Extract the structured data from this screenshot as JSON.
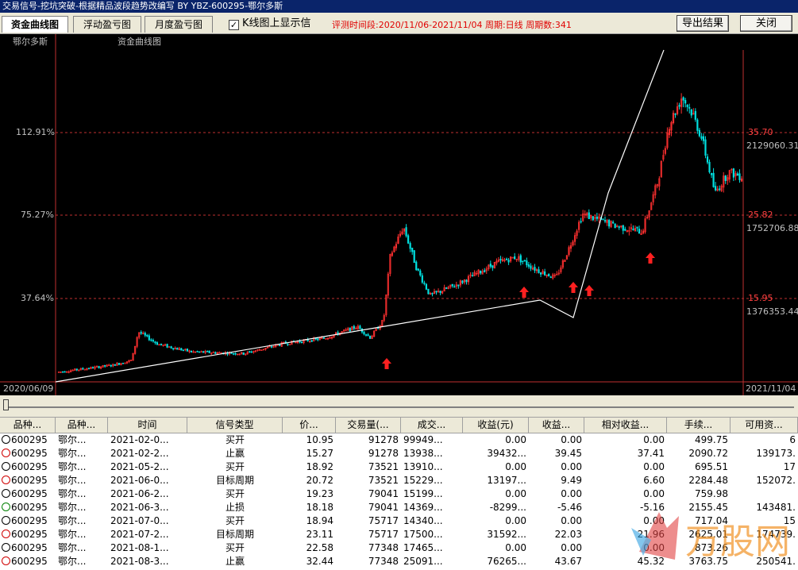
{
  "window": {
    "title": "交易信号-挖坑突破-根据精品波段趋势改编写 BY YBZ-600295-鄂尔多斯"
  },
  "tabs": [
    {
      "label": "资金曲线图",
      "active": true
    },
    {
      "label": "浮动盈亏图",
      "active": false
    },
    {
      "label": "月度盈亏图",
      "active": false
    }
  ],
  "kline_checkbox": {
    "label": "K线图上显示信",
    "checked": true
  },
  "period_info": "评测时间段:2020/11/06-2021/11/04  周期:日线  周期数:341",
  "buttons": {
    "export": "导出结果",
    "close": "关闭"
  },
  "chart": {
    "stock_name": "鄂尔多斯",
    "title": "资金曲线图",
    "left_axis": [
      "112.91%",
      "75.27%",
      "37.64%"
    ],
    "right_price": [
      "35.70",
      "25.82",
      "15.95"
    ],
    "right_capital": [
      "2129060.31",
      "1752706.88",
      "1376353.44"
    ],
    "date_start": "2020/06/09",
    "date_end": "2021/11/04",
    "colors": {
      "up": "#ff3030",
      "down": "#00e0e0",
      "line": "#ffffff",
      "grid": "#c03030",
      "signal": "#ff2020"
    }
  },
  "chart_data": {
    "type": "line",
    "x": [
      "2020/06/09",
      "2021-02-0..",
      "2021-05-2..",
      "2021-06-0..",
      "2021-07-0..",
      "2021-08-3.."
    ],
    "series": [],
    "ylabel": "",
    "left_ticks": [
      "112.91%",
      "75.27%",
      "37.64%"
    ],
    "right_price_ticks": [
      35.7,
      25.82,
      15.95
    ],
    "right_capital_ticks": [
      2129060.31,
      1752706.88,
      1376353.44
    ],
    "price_range_visible": [
      7,
      42
    ],
    "capital_curve_points": [
      [
        0,
        0.0
      ],
      [
        0.68,
        0.38
      ],
      [
        0.75,
        0.43
      ],
      [
        0.78,
        0.38
      ],
      [
        0.82,
        0.74
      ],
      [
        1.0,
        1.2
      ]
    ],
    "buy_signal_positions": [
      0.48,
      0.66,
      0.72,
      0.74,
      0.82
    ]
  },
  "table": {
    "headers": [
      "品种...",
      "品种...",
      "时间",
      "信号类型",
      "价...",
      "交易量(...",
      "成交...",
      "收益(元)",
      "收益...",
      "相对收益...",
      "手续...",
      "可用资..."
    ],
    "rows": [
      {
        "face": "black",
        "code": "600295",
        "name": "鄂尔...",
        "time": "2021-02-0...",
        "type": "买开",
        "price": "10.95",
        "volume": "91278",
        "amount": "99949...",
        "profit": "0.00",
        "profit_pct": "0.00",
        "rel": "0.00",
        "fee": "499.75",
        "avail": "6"
      },
      {
        "face": "red",
        "code": "600295",
        "name": "鄂尔...",
        "time": "2021-02-2...",
        "type": "止赢",
        "price": "15.27",
        "volume": "91278",
        "amount": "13938...",
        "profit": "39432...",
        "profit_pct": "39.45",
        "rel": "37.41",
        "fee": "2090.72",
        "avail": "139173."
      },
      {
        "face": "black",
        "code": "600295",
        "name": "鄂尔...",
        "time": "2021-05-2...",
        "type": "买开",
        "price": "18.92",
        "volume": "73521",
        "amount": "13910...",
        "profit": "0.00",
        "profit_pct": "0.00",
        "rel": "0.00",
        "fee": "695.51",
        "avail": "17"
      },
      {
        "face": "red",
        "code": "600295",
        "name": "鄂尔...",
        "time": "2021-06-0...",
        "type": "目标周期",
        "price": "20.72",
        "volume": "73521",
        "amount": "15229...",
        "profit": "13197...",
        "profit_pct": "9.49",
        "rel": "6.60",
        "fee": "2284.48",
        "avail": "152072."
      },
      {
        "face": "black",
        "code": "600295",
        "name": "鄂尔...",
        "time": "2021-06-2...",
        "type": "买开",
        "price": "19.23",
        "volume": "79041",
        "amount": "15199...",
        "profit": "0.00",
        "profit_pct": "0.00",
        "rel": "0.00",
        "fee": "759.98",
        "avail": ""
      },
      {
        "face": "green",
        "code": "600295",
        "name": "鄂尔...",
        "time": "2021-06-3...",
        "type": "止损",
        "price": "18.18",
        "volume": "79041",
        "amount": "14369...",
        "profit": "-8299...",
        "profit_pct": "-5.46",
        "rel": "-5.16",
        "fee": "2155.45",
        "avail": "143481."
      },
      {
        "face": "black",
        "code": "600295",
        "name": "鄂尔...",
        "time": "2021-07-0...",
        "type": "买开",
        "price": "18.94",
        "volume": "75717",
        "amount": "14340...",
        "profit": "0.00",
        "profit_pct": "0.00",
        "rel": "0.00",
        "fee": "717.04",
        "avail": "15"
      },
      {
        "face": "red",
        "code": "600295",
        "name": "鄂尔...",
        "time": "2021-07-2...",
        "type": "目标周期",
        "price": "23.11",
        "volume": "75717",
        "amount": "17500...",
        "profit": "31592...",
        "profit_pct": "22.03",
        "rel": "21.96",
        "fee": "2625.01",
        "avail": "174739."
      },
      {
        "face": "black",
        "code": "600295",
        "name": "鄂尔...",
        "time": "2021-08-1...",
        "type": "买开",
        "price": "22.58",
        "volume": "77348",
        "amount": "17465...",
        "profit": "0.00",
        "profit_pct": "0.00",
        "rel": "0.00",
        "fee": "873.26",
        "avail": ""
      },
      {
        "face": "red",
        "code": "600295",
        "name": "鄂尔...",
        "time": "2021-08-3...",
        "type": "止赢",
        "price": "32.44",
        "volume": "77348",
        "amount": "25091...",
        "profit": "76265...",
        "profit_pct": "43.67",
        "rel": "45.32",
        "fee": "3763.75",
        "avail": "250541."
      }
    ]
  },
  "watermark": {
    "text": "万股网"
  }
}
